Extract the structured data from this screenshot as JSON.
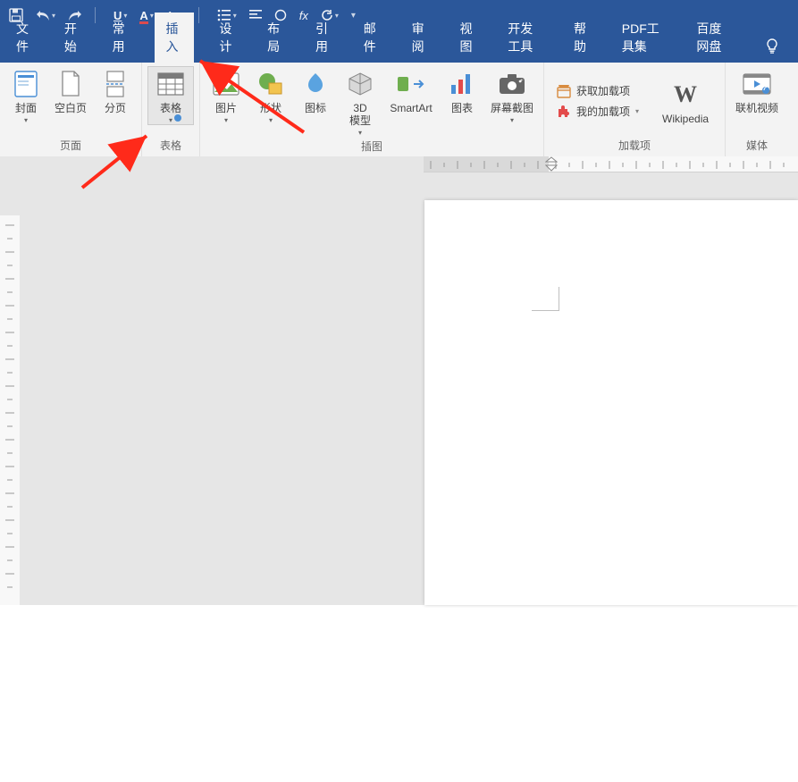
{
  "qat": {
    "save": "保存",
    "undo": "撤销",
    "redo": "重做",
    "underline": "U",
    "font_color": "A",
    "case": "Aa",
    "fx": "fx"
  },
  "tabs": {
    "file": "文件",
    "home": "开始",
    "common": "常用",
    "insert": "插入",
    "design": "设计",
    "layout": "布局",
    "references": "引用",
    "mailings": "邮件",
    "review": "审阅",
    "view": "视图",
    "devtools": "开发工具",
    "help": "帮助",
    "pdf": "PDF工具集",
    "baidu": "百度网盘"
  },
  "ribbon": {
    "pages": {
      "label": "页面",
      "cover": "封面",
      "blank": "空白页",
      "break": "分页"
    },
    "tables": {
      "label": "表格",
      "table": "表格"
    },
    "illustrations": {
      "label": "插图",
      "picture": "图片",
      "shapes": "形状",
      "icons": "图标",
      "model3d": "3D\n模型",
      "smartart": "SmartArt",
      "chart": "图表",
      "screenshot": "屏幕截图"
    },
    "addins": {
      "label": "加载项",
      "get": "获取加载项",
      "my": "我的加载项",
      "wikipedia": "Wikipedia"
    },
    "media": {
      "label": "媒体",
      "onlinevideo": "联机视频"
    }
  },
  "colors": {
    "brand": "#2B579A",
    "ribbon": "#F3F3F3",
    "accent_orange": "#D88B3F",
    "accent_red": "#E34B4B",
    "accent_green": "#6FAE4F",
    "accent_blue": "#4A8FD6"
  }
}
